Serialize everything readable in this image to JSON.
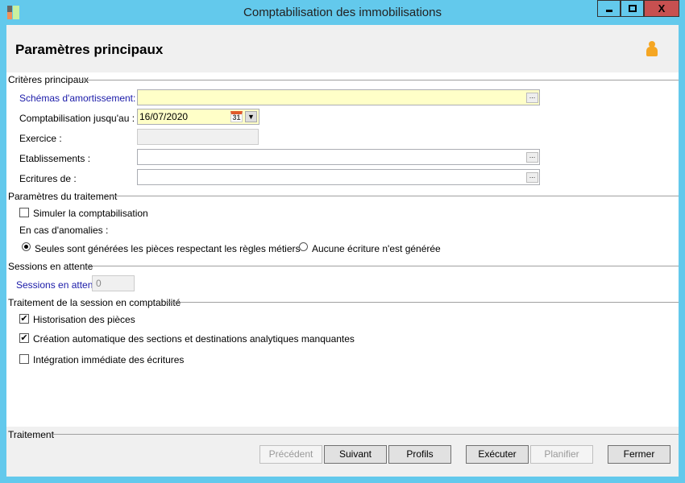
{
  "window": {
    "title": "Comptabilisation des immobilisations",
    "minimize": "▁",
    "maximize": "□",
    "close": "X"
  },
  "header": {
    "title": "Paramètres principaux",
    "icon": "user-icon"
  },
  "criteres": {
    "title": "Critères principaux",
    "schemas_label": "Schémas d'amortissement:",
    "schemas_value": "",
    "compta_label": "Comptabilisation jusqu'au :",
    "compta_value": "16/07/2020",
    "calendar_day": "31",
    "exercice_label": "Exercice :",
    "exercice_value": "",
    "etab_label": "Etablissements :",
    "etab_value": "",
    "ecritures_label": "Ecritures de :",
    "ecritures_value": "",
    "dots": "..."
  },
  "traitement": {
    "title": "Paramètres du traitement",
    "simuler": "Simuler la comptabilisation",
    "simuler_checked": false,
    "anomalies": "En cas d'anomalies :",
    "radio1": "Seules sont générées les pièces respectant les règles métiers",
    "radio2": "Aucune écriture n'est générée",
    "selected": 1
  },
  "sessions": {
    "title": "Sessions en attente",
    "label": "Sessions en attente",
    "value": "0"
  },
  "session_compta": {
    "title": "Traitement de la session en comptabilité",
    "items": [
      {
        "label": "Historisation des pièces",
        "checked": true
      },
      {
        "label": "Création automatique des sections et destinations analytiques manquantes",
        "checked": true
      },
      {
        "label": "Intégration immédiate des écritures",
        "checked": false
      }
    ]
  },
  "footer": {
    "title": "Traitement",
    "precedent": "Précédent",
    "suivant": "Suivant",
    "profils": "Profils",
    "executer": "Exécuter",
    "planifier": "Planifier",
    "fermer": "Fermer"
  },
  "colors": {
    "titlebar": "#63c9ec",
    "close": "#c75050",
    "required": "#ffffc8"
  }
}
